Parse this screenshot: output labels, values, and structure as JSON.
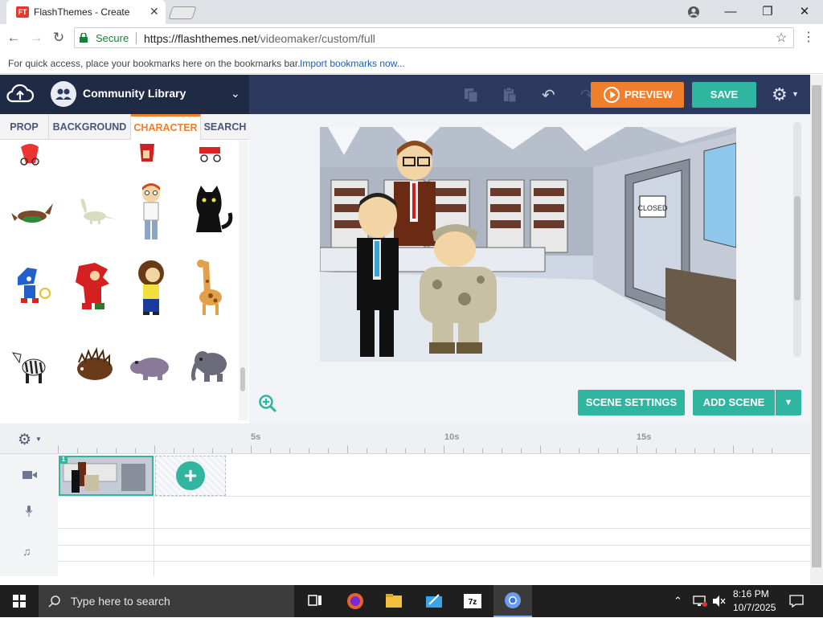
{
  "browser": {
    "tab_title": "FlashThemes - Create",
    "tab_favicon": "FT",
    "secure_label": "Secure",
    "url_host": "https://flashthemes.net",
    "url_path": "/videomaker/custom/full",
    "bookmarks_hint": "For quick access, place your bookmarks here on the bookmarks bar.",
    "bookmarks_link": "Import bookmarks now..."
  },
  "header": {
    "library_name": "Community Library",
    "preview_label": "PREVIEW",
    "save_label": "SAVE"
  },
  "library": {
    "tabs": [
      {
        "label": "PROP",
        "active": false
      },
      {
        "label": "BACKGROUND",
        "active": false
      },
      {
        "label": "CHARACTER",
        "active": true
      },
      {
        "label": "SEARCH",
        "active": false
      }
    ]
  },
  "stage": {
    "scene_settings_label": "SCENE SETTINGS",
    "add_scene_label": "ADD SCENE",
    "door_sign": "CLOSED"
  },
  "timeline": {
    "ruler_labels": [
      "5s",
      "10s",
      "15s"
    ],
    "scene_number": "1"
  },
  "taskbar": {
    "search_placeholder": "Type here to search",
    "time": "8:16 PM",
    "date": "10/7/2025"
  },
  "colors": {
    "accent_orange": "#f07f2d",
    "accent_teal": "#2fb5a0",
    "header_navy": "#2c3a60"
  }
}
